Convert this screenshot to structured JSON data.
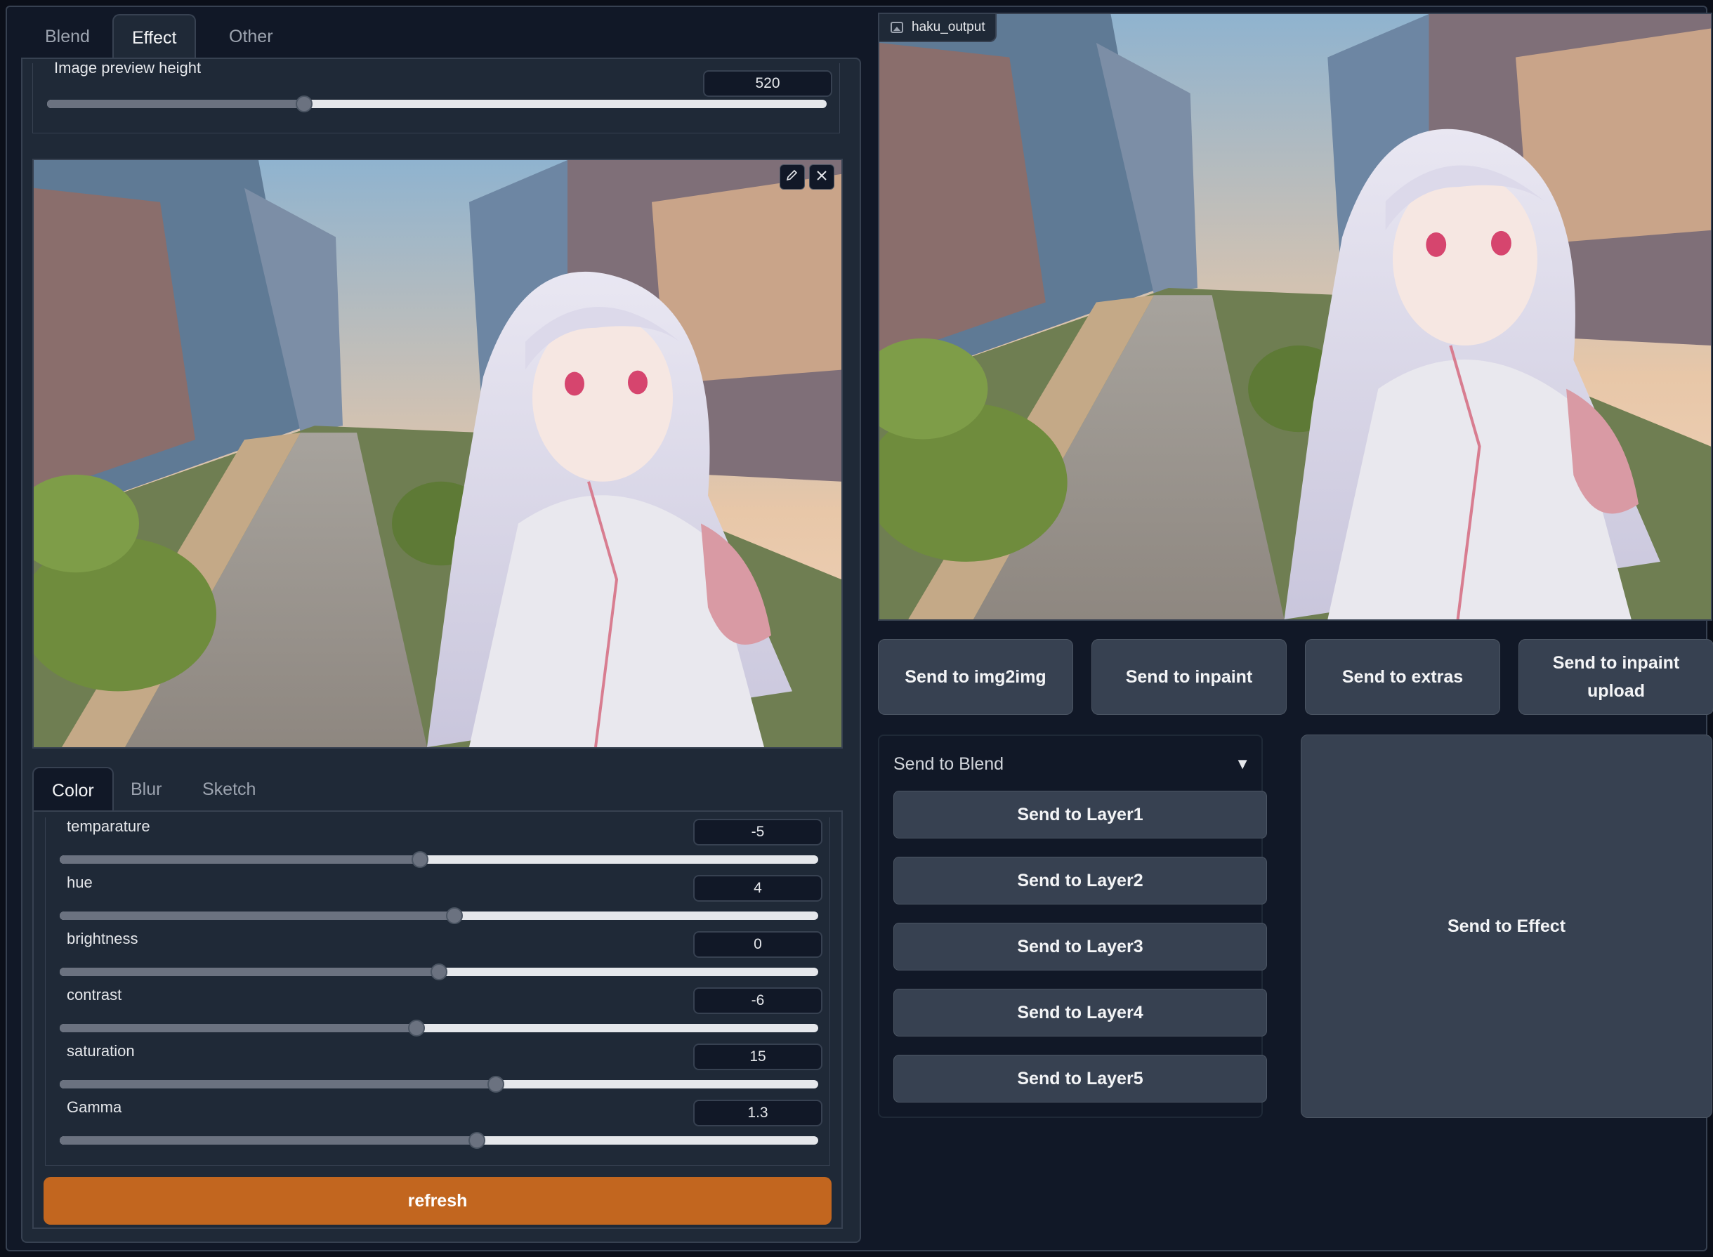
{
  "main_tabs": [
    {
      "label": "Blend",
      "active": false
    },
    {
      "label": "Effect",
      "active": true
    },
    {
      "label": "Other",
      "active": false
    }
  ],
  "preview_height": {
    "label": "Image preview height",
    "value": "520",
    "fraction": 0.33
  },
  "image_actions": {
    "edit_icon": "pencil-icon",
    "close_icon": "close-icon"
  },
  "sub_tabs": [
    {
      "label": "Color",
      "active": true
    },
    {
      "label": "Blur",
      "active": false
    },
    {
      "label": "Sketch",
      "active": false
    }
  ],
  "color_sliders": [
    {
      "label": "temparature",
      "value": "-5",
      "fraction": 0.475
    },
    {
      "label": "hue",
      "value": "4",
      "fraction": 0.52
    },
    {
      "label": "brightness",
      "value": "0",
      "fraction": 0.5
    },
    {
      "label": "contrast",
      "value": "-6",
      "fraction": 0.47
    },
    {
      "label": "saturation",
      "value": "15",
      "fraction": 0.575
    },
    {
      "label": "Gamma",
      "value": "1.3",
      "fraction": 0.55
    }
  ],
  "refresh_label": "refresh",
  "output": {
    "label": "haku_output",
    "icon": "image-icon"
  },
  "send_buttons": [
    "Send to img2img",
    "Send to inpaint",
    "Send to extras",
    "Send to inpaint upload"
  ],
  "blend": {
    "header": "Send to Blend",
    "caret": "▼",
    "layers": [
      "Send to Layer1",
      "Send to Layer2",
      "Send to Layer3",
      "Send to Layer4",
      "Send to Layer5"
    ]
  },
  "effect_label": "Send to Effect",
  "colors": {
    "accent": "#c2661f",
    "panel": "#1f2937",
    "background": "#0b0f19"
  }
}
